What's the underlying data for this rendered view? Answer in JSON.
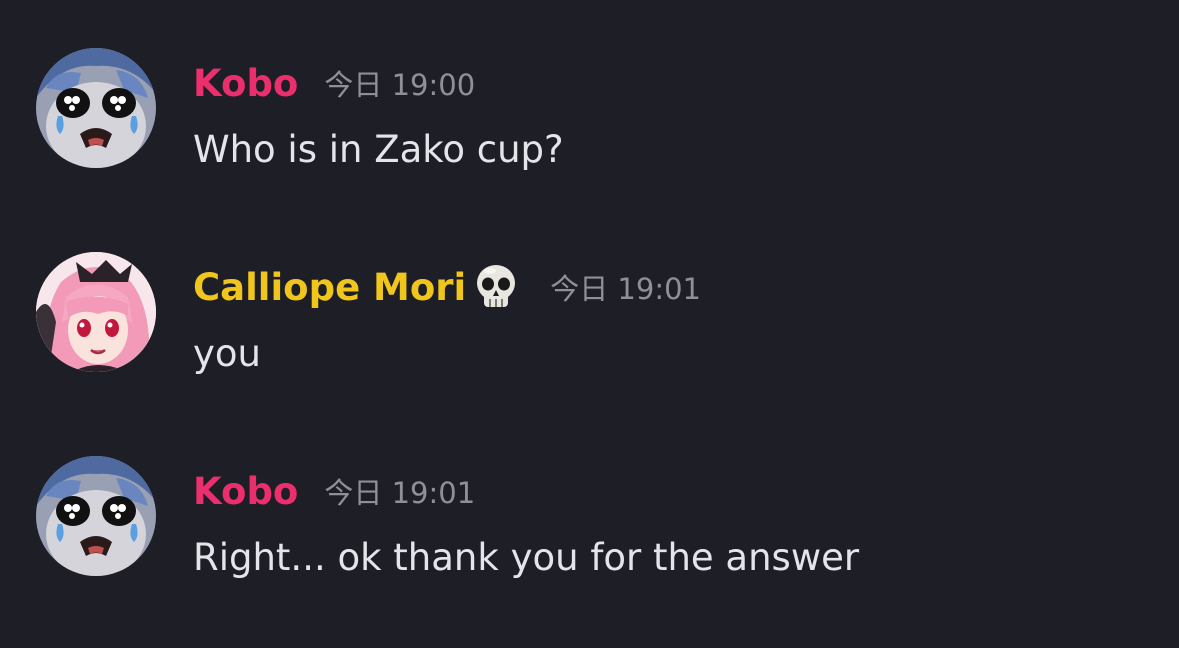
{
  "messages": [
    {
      "author": "Kobo",
      "author_color": "#ea2f6c",
      "avatar": "kobo-crying-avatar",
      "timestamp": "今日 19:00",
      "text": "Who is in Zako cup?"
    },
    {
      "author": "Calliope Mori",
      "author_color": "#f0c51c",
      "author_badge": "💀",
      "avatar": "calliope-mori-avatar",
      "timestamp": "今日 19:01",
      "text": "you"
    },
    {
      "author": "Kobo",
      "author_color": "#ea2f6c",
      "avatar": "kobo-crying-avatar",
      "timestamp": "今日 19:01",
      "text": "Right... ok thank you for the answer"
    }
  ],
  "theme": {
    "background": "#1e1f26",
    "message_text": "#e3e5ea",
    "timestamp_text": "#8e9099"
  }
}
